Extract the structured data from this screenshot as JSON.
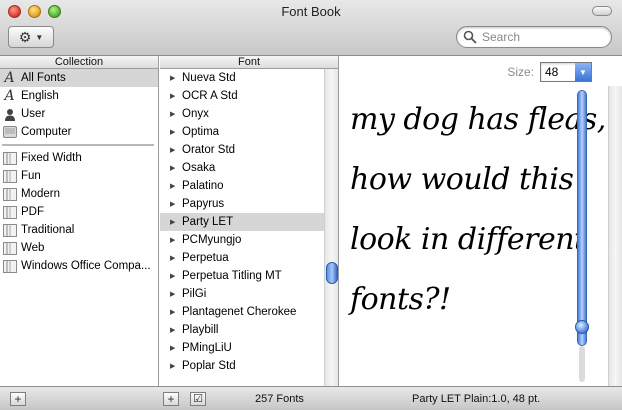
{
  "window": {
    "title": "Font Book"
  },
  "toolbar": {
    "search_placeholder": "Search"
  },
  "columns": {
    "collection": "Collection",
    "font": "Font"
  },
  "collections": {
    "group1": [
      {
        "label": "All Fonts",
        "icon": "font-glyph-icon",
        "selected": true
      },
      {
        "label": "English",
        "icon": "font-glyph-icon",
        "selected": false
      },
      {
        "label": "User",
        "icon": "user-icon",
        "selected": false
      },
      {
        "label": "Computer",
        "icon": "computer-icon",
        "selected": false
      }
    ],
    "group2": [
      {
        "label": "Fixed Width",
        "icon": "collection-book-icon"
      },
      {
        "label": "Fun",
        "icon": "collection-book-icon"
      },
      {
        "label": "Modern",
        "icon": "collection-book-icon"
      },
      {
        "label": "PDF",
        "icon": "collection-book-icon"
      },
      {
        "label": "Traditional",
        "icon": "collection-book-icon"
      },
      {
        "label": "Web",
        "icon": "collection-book-icon"
      },
      {
        "label": "Windows Office Compa...",
        "icon": "collection-book-icon"
      }
    ]
  },
  "fonts": [
    {
      "label": "Nueva Std",
      "selected": false
    },
    {
      "label": "OCR A Std",
      "selected": false
    },
    {
      "label": "Onyx",
      "selected": false
    },
    {
      "label": "Optima",
      "selected": false
    },
    {
      "label": "Orator Std",
      "selected": false
    },
    {
      "label": "Osaka",
      "selected": false
    },
    {
      "label": "Palatino",
      "selected": false
    },
    {
      "label": "Papyrus",
      "selected": false
    },
    {
      "label": "Party LET",
      "selected": true
    },
    {
      "label": "PCMyungjo",
      "selected": false
    },
    {
      "label": "Perpetua",
      "selected": false
    },
    {
      "label": "Perpetua Titling MT",
      "selected": false
    },
    {
      "label": "PilGi",
      "selected": false
    },
    {
      "label": "Plantagenet Cherokee",
      "selected": false
    },
    {
      "label": "Playbill",
      "selected": false
    },
    {
      "label": "PMingLiU",
      "selected": false
    },
    {
      "label": "Poplar Std",
      "selected": false
    }
  ],
  "preview": {
    "size_label": "Size:",
    "size_value": "48",
    "lines": [
      "my dog has fleas,",
      "how would this",
      "look in different",
      "fonts?!"
    ]
  },
  "status": {
    "font_count": "257 Fonts",
    "font_info": "Party LET Plain:1.0, 48 pt."
  },
  "colors": {
    "selection_gray": "#d6d6d6",
    "accent_blue": "#3a74d8"
  }
}
